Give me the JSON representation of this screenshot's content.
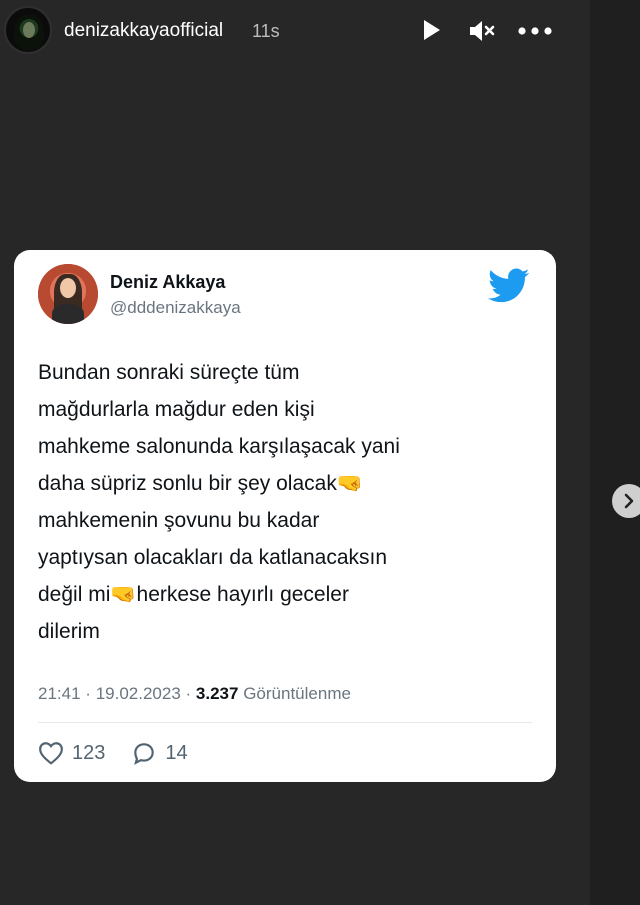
{
  "story": {
    "username": "denizakkayaofficial",
    "elapsed": "11s",
    "controls": [
      "play-icon",
      "mute-icon",
      "more-icon"
    ]
  },
  "tweet": {
    "author_name": "Deniz Akkaya",
    "author_handle": "@dddenizakkaya",
    "text": "Bundan sonraki süreçte tüm\nmağdurlarla mağdur eden kişi\nmahkeme salonunda karşılaşacak yani\ndaha süpriz sonlu bir şey olacak🤜\nmahkemenin şovunu bu kadar\nyaptıysan olacakları da katlanacaksın\ndeğil mi🤜herkese hayırlı geceler\ndilerim",
    "time": "21:41",
    "date": "19.02.2023",
    "separator": "·",
    "views_count": "3.237",
    "views_label": "Görüntülenme",
    "likes": "123",
    "replies": "14"
  },
  "colors": {
    "background": "#272727",
    "card": "#ffffff",
    "twitter_blue": "#1d9bf0"
  }
}
